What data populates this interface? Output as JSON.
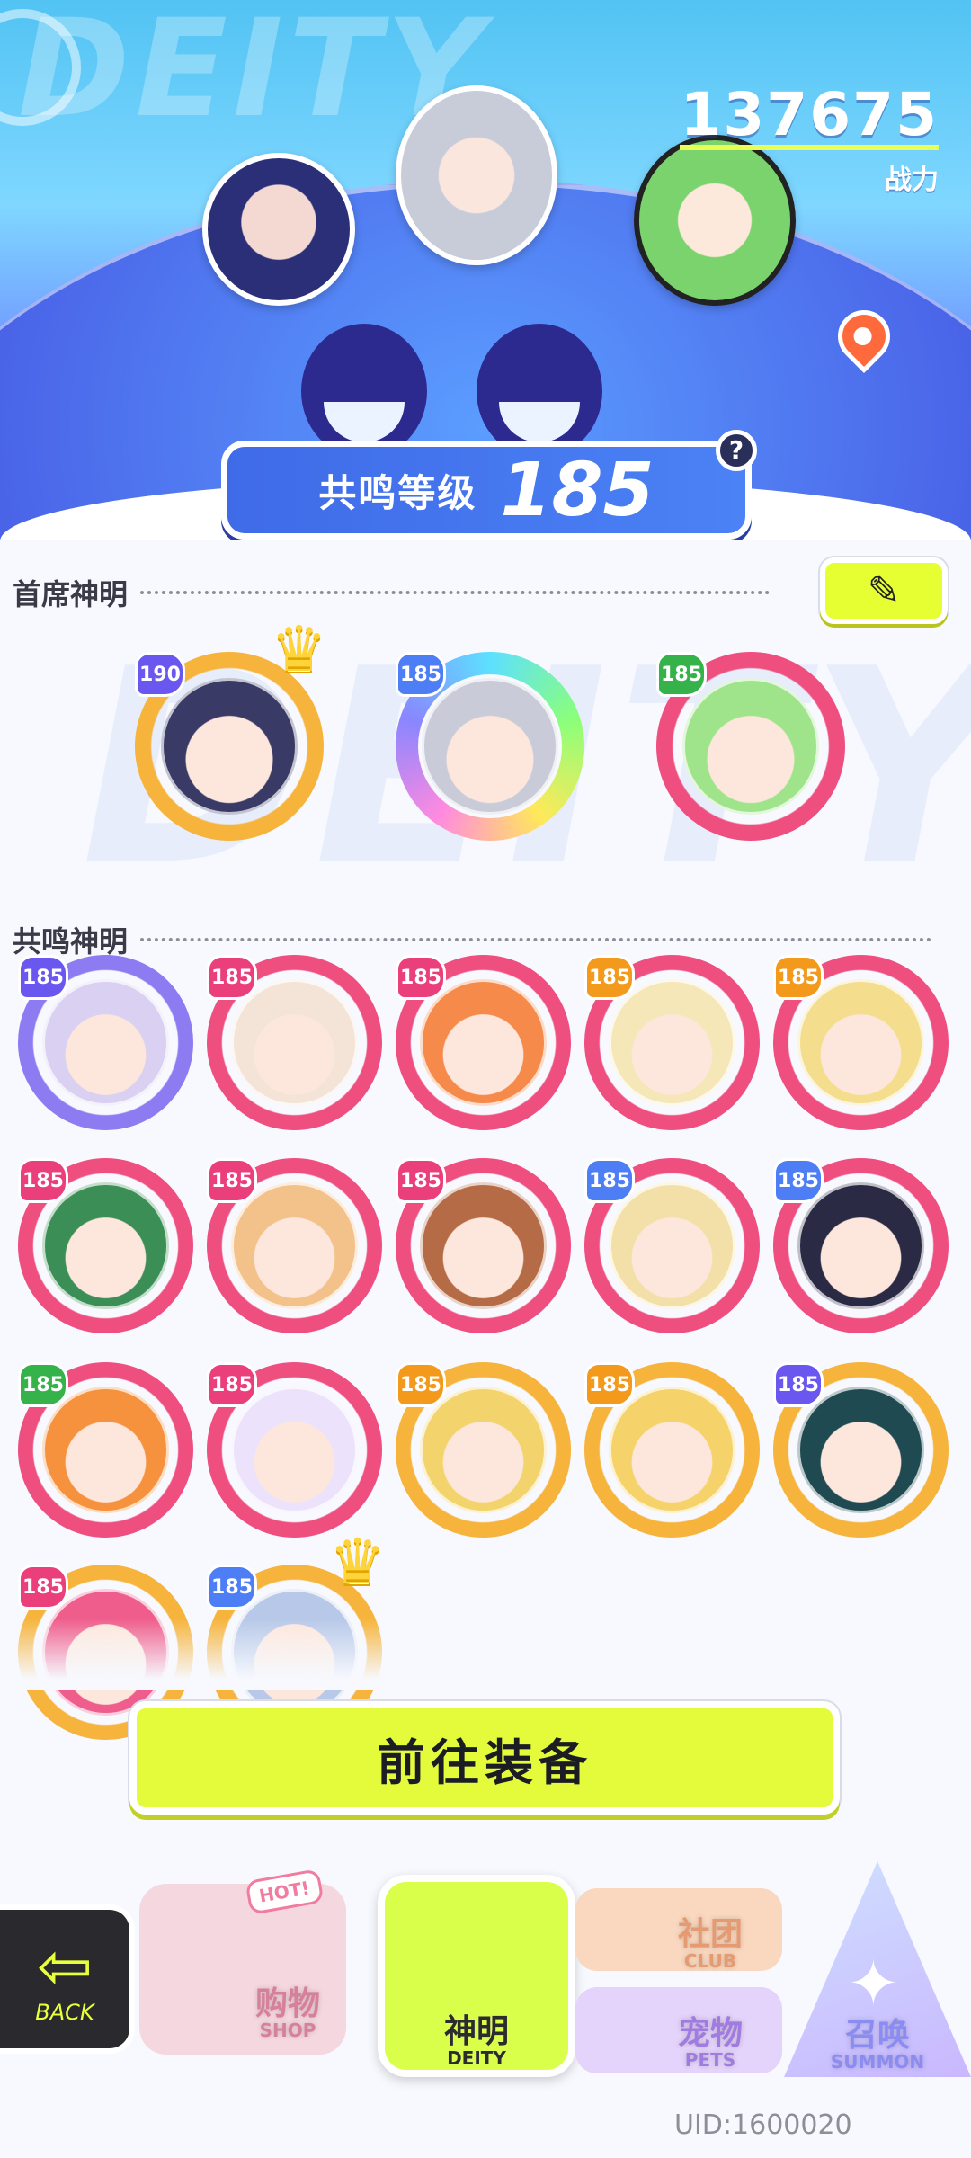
{
  "header": {
    "bg_word": "DEITY",
    "power_value": "137675",
    "power_label": "战力",
    "level_label": "共鸣等级",
    "level_value": "185",
    "help_symbol": "?"
  },
  "chief": {
    "title": "首席神明",
    "edit_icon": "pencil-icon",
    "deities": [
      {
        "level": "190",
        "ring": "yellow",
        "badge": "purple",
        "crown": true,
        "face": "#3a3a66"
      },
      {
        "level": "185",
        "ring": "rainbow",
        "badge": "blue",
        "crown": false,
        "face": "#c9ccd8"
      },
      {
        "level": "185",
        "ring": "pink",
        "badge": "green",
        "crown": false,
        "face": "#9fe48b"
      }
    ]
  },
  "resonance": {
    "title": "共鸣神明",
    "deities": [
      {
        "level": "185",
        "ring": "purple",
        "badge": "purple",
        "face": "#d9d0f2"
      },
      {
        "level": "185",
        "ring": "pink",
        "badge": "pink",
        "face": "#f4e4d8"
      },
      {
        "level": "185",
        "ring": "pink",
        "badge": "pink",
        "face": "#f58a4a"
      },
      {
        "level": "185",
        "ring": "pink",
        "badge": "gold",
        "face": "#f6e7b8"
      },
      {
        "level": "185",
        "ring": "pink",
        "badge": "gold",
        "face": "#f4dd8c"
      },
      {
        "level": "185",
        "ring": "pink",
        "badge": "pink",
        "face": "#3b8f56"
      },
      {
        "level": "185",
        "ring": "pink",
        "badge": "pink",
        "face": "#f3c18a"
      },
      {
        "level": "185",
        "ring": "pink",
        "badge": "pink",
        "face": "#b56b45"
      },
      {
        "level": "185",
        "ring": "pink",
        "badge": "blue",
        "face": "#f3e0a8"
      },
      {
        "level": "185",
        "ring": "pink",
        "badge": "blue",
        "face": "#2a2a45"
      },
      {
        "level": "185",
        "ring": "pink",
        "badge": "green",
        "face": "#f6913d"
      },
      {
        "level": "185",
        "ring": "pink",
        "badge": "pink",
        "face": "#ece2fb"
      },
      {
        "level": "185",
        "ring": "yellow",
        "badge": "gold",
        "face": "#f3d36b"
      },
      {
        "level": "185",
        "ring": "yellow",
        "badge": "gold",
        "face": "#f6d26a"
      },
      {
        "level": "185",
        "ring": "yellow",
        "badge": "purple",
        "face": "#1f4a52"
      },
      {
        "level": "185",
        "ring": "yellow",
        "badge": "pink",
        "face": "#ef5d8c"
      },
      {
        "level": "185",
        "ring": "yellow",
        "badge": "blue",
        "face": "#b7c8e8",
        "crown": true
      }
    ]
  },
  "equip_button": "前往装备",
  "nav": {
    "back": "BACK",
    "hot": "HOT!",
    "shop_zh": "购物",
    "shop_en": "SHOP",
    "deity_zh": "神明",
    "deity_en": "DEITY",
    "club_zh": "社团",
    "club_en": "CLUB",
    "pets_zh": "宠物",
    "pets_en": "PETS",
    "summon_zh": "召唤",
    "summon_en": "SUMMON"
  },
  "uid": "UID:1600020"
}
